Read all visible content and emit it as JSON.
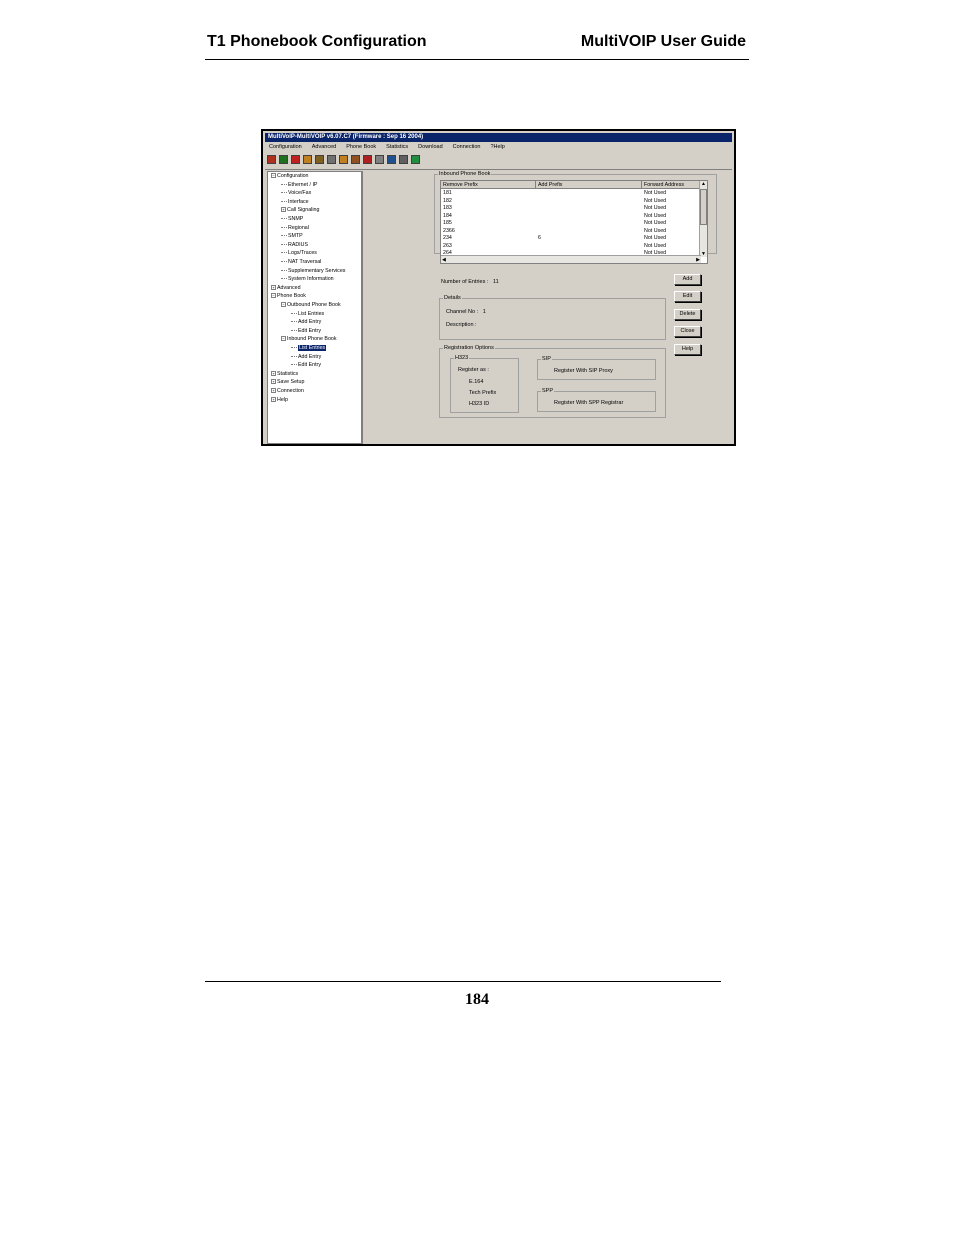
{
  "header": {
    "left": "T1 Phonebook Configuration",
    "right": "MultiVOIP User Guide"
  },
  "footer": {
    "page_number": "184"
  },
  "app": {
    "title": "MultiVoIP-MultiVOIP v6.07.C7 (Firmware : Sep 16 2004)",
    "menu": [
      "Configuration",
      "Advanced",
      "Phone Book",
      "Statistics",
      "Download",
      "Connection",
      "?Help"
    ],
    "toolbar_icons": [
      {
        "name": "network-icon",
        "color": "#b03020"
      },
      {
        "name": "monitor-green-icon",
        "color": "#207020"
      },
      {
        "name": "monitor-red-icon",
        "color": "#c02020"
      },
      {
        "name": "phone-icon",
        "color": "#c08020"
      },
      {
        "name": "phone-book-icon",
        "color": "#806020"
      },
      {
        "name": "settings-icon",
        "color": "#707070"
      },
      {
        "name": "call-icon",
        "color": "#c08020"
      },
      {
        "name": "user-icon",
        "color": "#905020"
      },
      {
        "name": "graph-icon",
        "color": "#b02020"
      },
      {
        "name": "document-icon",
        "color": "#808080"
      },
      {
        "name": "mail-icon",
        "color": "#205090"
      },
      {
        "name": "printer-icon",
        "color": "#606060"
      },
      {
        "name": "globe-icon",
        "color": "#209040"
      }
    ],
    "tree": [
      {
        "label": "Configuration",
        "level": 0,
        "expander": "−"
      },
      {
        "label": "Ethernet / IP",
        "level": 1
      },
      {
        "label": "Voice/Fax",
        "level": 1
      },
      {
        "label": "Interface",
        "level": 1
      },
      {
        "label": "Call Signaling",
        "level": 1,
        "expander": "+"
      },
      {
        "label": "SNMP",
        "level": 1
      },
      {
        "label": "Regional",
        "level": 1
      },
      {
        "label": "SMTP",
        "level": 1
      },
      {
        "label": "RADIUS",
        "level": 1
      },
      {
        "label": "Logs/Traces",
        "level": 1
      },
      {
        "label": "NAT Traversal",
        "level": 1
      },
      {
        "label": "Supplementary Services",
        "level": 1
      },
      {
        "label": "System Information",
        "level": 1
      },
      {
        "label": "Advanced",
        "level": 0,
        "expander": "+"
      },
      {
        "label": "Phone Book",
        "level": 0,
        "expander": "−"
      },
      {
        "label": "Outbound Phone Book",
        "level": 1,
        "expander": "−"
      },
      {
        "label": "List Entries",
        "level": 2
      },
      {
        "label": "Add Entry",
        "level": 2
      },
      {
        "label": "Edit Entry",
        "level": 2
      },
      {
        "label": "Inbound Phone Book",
        "level": 1,
        "expander": "−"
      },
      {
        "label": "List Entries",
        "level": 2,
        "selected": true
      },
      {
        "label": "Add Entry",
        "level": 2
      },
      {
        "label": "Edit Entry",
        "level": 2
      },
      {
        "label": "Statistics",
        "level": 0,
        "expander": "+"
      },
      {
        "label": "Save Setup",
        "level": 0,
        "expander": "+"
      },
      {
        "label": "Connection",
        "level": 0,
        "expander": "+"
      },
      {
        "label": "Help",
        "level": 0,
        "expander": "+"
      }
    ],
    "inbound": {
      "group_label": "Inbound Phone Book",
      "columns": [
        "Remove Prefix",
        "Add Prefix",
        "Forward Address"
      ],
      "rows": [
        [
          "181",
          "",
          "Not Used"
        ],
        [
          "182",
          "",
          "Not Used"
        ],
        [
          "183",
          "",
          "Not Used"
        ],
        [
          "184",
          "",
          "Not Used"
        ],
        [
          "185",
          "",
          "Not Used"
        ],
        [
          "2366",
          "",
          "Not Used"
        ],
        [
          "234",
          "6",
          "Not Used"
        ],
        [
          "263",
          "",
          "Not Used"
        ],
        [
          "264",
          "",
          "Not Used"
        ]
      ],
      "entries_label": "Number of Entries :",
      "entries_value": "11"
    },
    "details": {
      "group_label": "Details",
      "channel_label": "Channel No :",
      "channel_value": "1",
      "description_label": "Description :"
    },
    "registration": {
      "group_label": "Registration Options",
      "h323_label": "H323",
      "register_as": "Register as :",
      "e164": "E.164",
      "tech_prefix": "Tech Prefix",
      "h323_id": "H323 ID",
      "sip_label": "SIP",
      "sip_option": "Register With SIP Proxy",
      "spp_label": "SPP",
      "spp_option": "Register With SPP Registrar"
    },
    "buttons": [
      "Add",
      "Edit",
      "Delete",
      "Close",
      "Help"
    ]
  }
}
